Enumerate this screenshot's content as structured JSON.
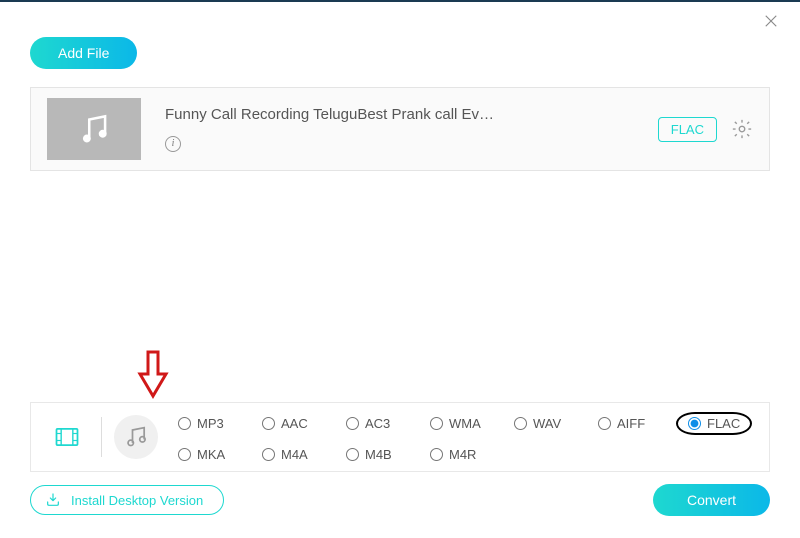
{
  "header": {
    "add_file_label": "Add File"
  },
  "file": {
    "title": "Funny Call Recording TeluguBest Prank call Ev…",
    "target_format": "FLAC"
  },
  "format_panel": {
    "row1": [
      "MP3",
      "AAC",
      "AC3",
      "WMA",
      "WAV",
      "AIFF"
    ],
    "row2": [
      "MKA",
      "M4A",
      "M4B",
      "M4R"
    ],
    "selected": "FLAC"
  },
  "footer": {
    "install_label": "Install Desktop Version",
    "convert_label": "Convert"
  }
}
